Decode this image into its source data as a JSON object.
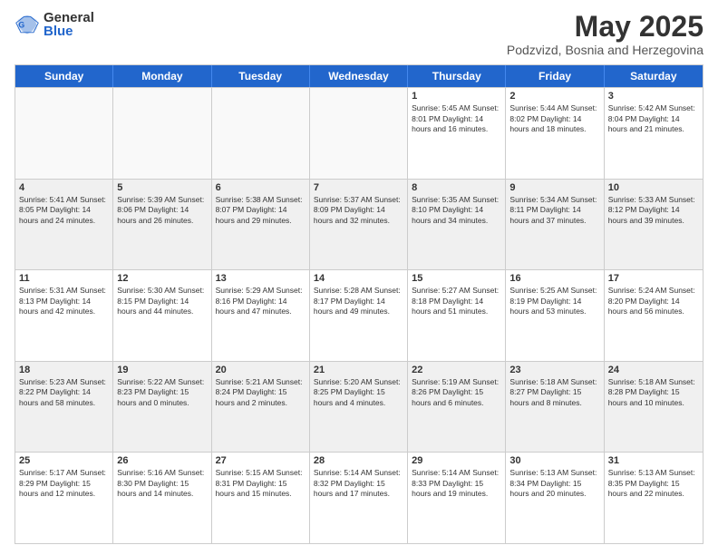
{
  "logo": {
    "general": "General",
    "blue": "Blue"
  },
  "header": {
    "month": "May 2025",
    "location": "Podzvizd, Bosnia and Herzegovina"
  },
  "weekdays": [
    "Sunday",
    "Monday",
    "Tuesday",
    "Wednesday",
    "Thursday",
    "Friday",
    "Saturday"
  ],
  "weeks": [
    [
      {
        "day": "",
        "info": ""
      },
      {
        "day": "",
        "info": ""
      },
      {
        "day": "",
        "info": ""
      },
      {
        "day": "",
        "info": ""
      },
      {
        "day": "1",
        "info": "Sunrise: 5:45 AM\nSunset: 8:01 PM\nDaylight: 14 hours\nand 16 minutes."
      },
      {
        "day": "2",
        "info": "Sunrise: 5:44 AM\nSunset: 8:02 PM\nDaylight: 14 hours\nand 18 minutes."
      },
      {
        "day": "3",
        "info": "Sunrise: 5:42 AM\nSunset: 8:04 PM\nDaylight: 14 hours\nand 21 minutes."
      }
    ],
    [
      {
        "day": "4",
        "info": "Sunrise: 5:41 AM\nSunset: 8:05 PM\nDaylight: 14 hours\nand 24 minutes."
      },
      {
        "day": "5",
        "info": "Sunrise: 5:39 AM\nSunset: 8:06 PM\nDaylight: 14 hours\nand 26 minutes."
      },
      {
        "day": "6",
        "info": "Sunrise: 5:38 AM\nSunset: 8:07 PM\nDaylight: 14 hours\nand 29 minutes."
      },
      {
        "day": "7",
        "info": "Sunrise: 5:37 AM\nSunset: 8:09 PM\nDaylight: 14 hours\nand 32 minutes."
      },
      {
        "day": "8",
        "info": "Sunrise: 5:35 AM\nSunset: 8:10 PM\nDaylight: 14 hours\nand 34 minutes."
      },
      {
        "day": "9",
        "info": "Sunrise: 5:34 AM\nSunset: 8:11 PM\nDaylight: 14 hours\nand 37 minutes."
      },
      {
        "day": "10",
        "info": "Sunrise: 5:33 AM\nSunset: 8:12 PM\nDaylight: 14 hours\nand 39 minutes."
      }
    ],
    [
      {
        "day": "11",
        "info": "Sunrise: 5:31 AM\nSunset: 8:13 PM\nDaylight: 14 hours\nand 42 minutes."
      },
      {
        "day": "12",
        "info": "Sunrise: 5:30 AM\nSunset: 8:15 PM\nDaylight: 14 hours\nand 44 minutes."
      },
      {
        "day": "13",
        "info": "Sunrise: 5:29 AM\nSunset: 8:16 PM\nDaylight: 14 hours\nand 47 minutes."
      },
      {
        "day": "14",
        "info": "Sunrise: 5:28 AM\nSunset: 8:17 PM\nDaylight: 14 hours\nand 49 minutes."
      },
      {
        "day": "15",
        "info": "Sunrise: 5:27 AM\nSunset: 8:18 PM\nDaylight: 14 hours\nand 51 minutes."
      },
      {
        "day": "16",
        "info": "Sunrise: 5:25 AM\nSunset: 8:19 PM\nDaylight: 14 hours\nand 53 minutes."
      },
      {
        "day": "17",
        "info": "Sunrise: 5:24 AM\nSunset: 8:20 PM\nDaylight: 14 hours\nand 56 minutes."
      }
    ],
    [
      {
        "day": "18",
        "info": "Sunrise: 5:23 AM\nSunset: 8:22 PM\nDaylight: 14 hours\nand 58 minutes."
      },
      {
        "day": "19",
        "info": "Sunrise: 5:22 AM\nSunset: 8:23 PM\nDaylight: 15 hours\nand 0 minutes."
      },
      {
        "day": "20",
        "info": "Sunrise: 5:21 AM\nSunset: 8:24 PM\nDaylight: 15 hours\nand 2 minutes."
      },
      {
        "day": "21",
        "info": "Sunrise: 5:20 AM\nSunset: 8:25 PM\nDaylight: 15 hours\nand 4 minutes."
      },
      {
        "day": "22",
        "info": "Sunrise: 5:19 AM\nSunset: 8:26 PM\nDaylight: 15 hours\nand 6 minutes."
      },
      {
        "day": "23",
        "info": "Sunrise: 5:18 AM\nSunset: 8:27 PM\nDaylight: 15 hours\nand 8 minutes."
      },
      {
        "day": "24",
        "info": "Sunrise: 5:18 AM\nSunset: 8:28 PM\nDaylight: 15 hours\nand 10 minutes."
      }
    ],
    [
      {
        "day": "25",
        "info": "Sunrise: 5:17 AM\nSunset: 8:29 PM\nDaylight: 15 hours\nand 12 minutes."
      },
      {
        "day": "26",
        "info": "Sunrise: 5:16 AM\nSunset: 8:30 PM\nDaylight: 15 hours\nand 14 minutes."
      },
      {
        "day": "27",
        "info": "Sunrise: 5:15 AM\nSunset: 8:31 PM\nDaylight: 15 hours\nand 15 minutes."
      },
      {
        "day": "28",
        "info": "Sunrise: 5:14 AM\nSunset: 8:32 PM\nDaylight: 15 hours\nand 17 minutes."
      },
      {
        "day": "29",
        "info": "Sunrise: 5:14 AM\nSunset: 8:33 PM\nDaylight: 15 hours\nand 19 minutes."
      },
      {
        "day": "30",
        "info": "Sunrise: 5:13 AM\nSunset: 8:34 PM\nDaylight: 15 hours\nand 20 minutes."
      },
      {
        "day": "31",
        "info": "Sunrise: 5:13 AM\nSunset: 8:35 PM\nDaylight: 15 hours\nand 22 minutes."
      }
    ]
  ],
  "colors": {
    "header_bg": "#2a6db5",
    "header_text": "#ffffff",
    "border": "#cccccc",
    "shaded": "#f0f0f0"
  }
}
